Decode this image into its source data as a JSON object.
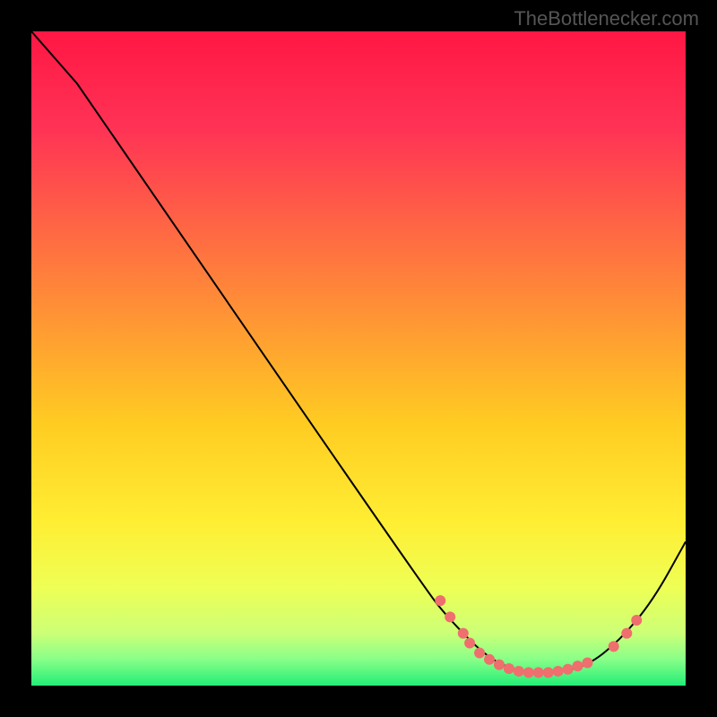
{
  "watermark": "TheBottlenecker.com",
  "chart_data": {
    "type": "line",
    "title": "",
    "xlabel": "",
    "ylabel": "",
    "xlim": [
      0,
      100
    ],
    "ylim": [
      0,
      100
    ],
    "curve_points": [
      {
        "x": 0,
        "y": 100
      },
      {
        "x": 7,
        "y": 92
      },
      {
        "x": 60,
        "y": 15
      },
      {
        "x": 64,
        "y": 10
      },
      {
        "x": 70,
        "y": 4
      },
      {
        "x": 75,
        "y": 2
      },
      {
        "x": 80,
        "y": 2
      },
      {
        "x": 85,
        "y": 3
      },
      {
        "x": 90,
        "y": 7
      },
      {
        "x": 95,
        "y": 13
      },
      {
        "x": 100,
        "y": 22
      }
    ],
    "markers": [
      {
        "x": 62.5,
        "y": 13
      },
      {
        "x": 64,
        "y": 10.5
      },
      {
        "x": 66,
        "y": 8
      },
      {
        "x": 67,
        "y": 6.5
      },
      {
        "x": 68.5,
        "y": 5
      },
      {
        "x": 70,
        "y": 4
      },
      {
        "x": 71.5,
        "y": 3.2
      },
      {
        "x": 73,
        "y": 2.6
      },
      {
        "x": 74.5,
        "y": 2.2
      },
      {
        "x": 76,
        "y": 2
      },
      {
        "x": 77.5,
        "y": 2
      },
      {
        "x": 79,
        "y": 2
      },
      {
        "x": 80.5,
        "y": 2.2
      },
      {
        "x": 82,
        "y": 2.5
      },
      {
        "x": 83.5,
        "y": 3
      },
      {
        "x": 85,
        "y": 3.5
      },
      {
        "x": 89,
        "y": 6
      },
      {
        "x": 91,
        "y": 8
      },
      {
        "x": 92.5,
        "y": 10
      }
    ],
    "gradient_stops": [
      {
        "offset": 0,
        "color": "#ff1744"
      },
      {
        "offset": 15,
        "color": "#ff3355"
      },
      {
        "offset": 30,
        "color": "#ff6644"
      },
      {
        "offset": 45,
        "color": "#ff9933"
      },
      {
        "offset": 60,
        "color": "#ffcc22"
      },
      {
        "offset": 75,
        "color": "#ffee33"
      },
      {
        "offset": 85,
        "color": "#eeff55"
      },
      {
        "offset": 92,
        "color": "#ccff77"
      },
      {
        "offset": 96,
        "color": "#88ff88"
      },
      {
        "offset": 100,
        "color": "#22ee77"
      }
    ],
    "marker_color": "#ef6e6e"
  }
}
